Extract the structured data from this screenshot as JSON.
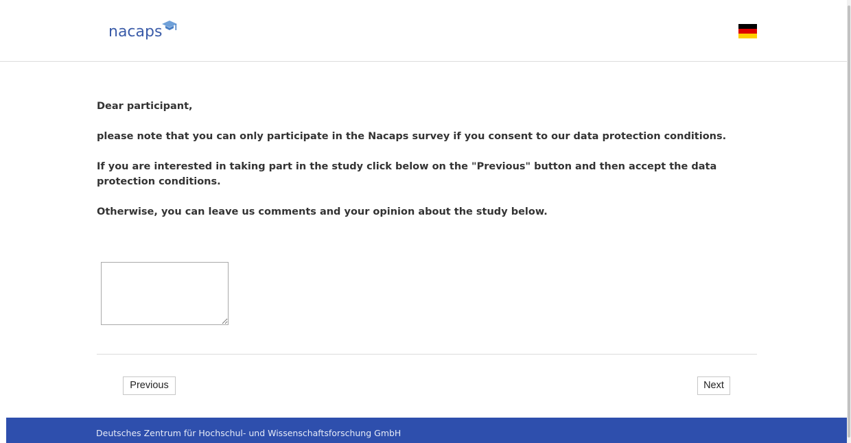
{
  "header": {
    "logo_text": "nacaps",
    "language_flag": "german-flag-icon"
  },
  "main": {
    "paragraphs": [
      "Dear participant,",
      "please note that you can only participate in the Nacaps survey if you consent to our data protection conditions.",
      "If you are interested in taking part in the study click below on the \"Previous\" button and then accept the data protection conditions.",
      "Otherwise, you can leave us comments and your opinion about the study below."
    ],
    "comment_value": ""
  },
  "navigation": {
    "previous_label": "Previous",
    "next_label": "Next"
  },
  "footer": {
    "text": "Deutsches Zentrum für Hochschul- und Wissenschaftsforschung GmbH"
  },
  "colors": {
    "brand_blue": "#3a5ba8",
    "footer_bg": "#2e4fad"
  }
}
